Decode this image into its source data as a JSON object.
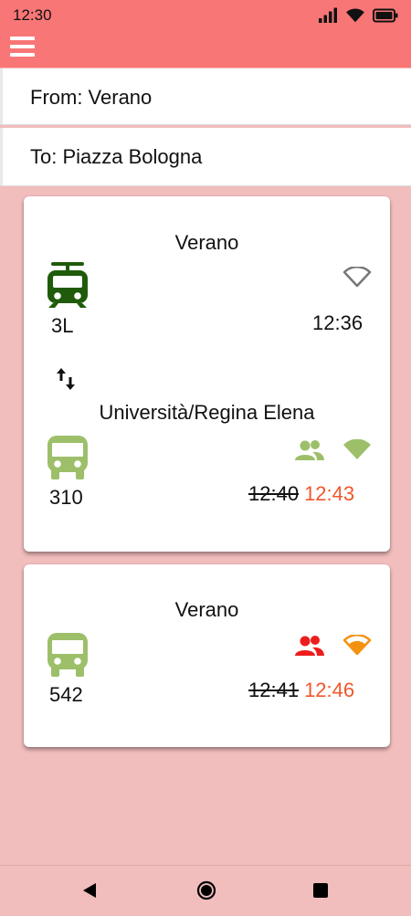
{
  "status": {
    "time": "12:30"
  },
  "search": {
    "from_text": "From: Verano",
    "to_text": "To: Piazza Bologna"
  },
  "colors": {
    "app_bar": "#f87676",
    "background": "#f2bdbd",
    "tram": "#1f5b0a",
    "bus": "#9dbf6a",
    "delay": "#f0572b",
    "crowd_high": "#ee1d1d",
    "signal_medium": "#f4920f"
  },
  "cards": [
    {
      "legs": [
        {
          "stop": "Verano",
          "vehicle_icon": "tram-icon",
          "line": "3L",
          "indicators": [
            "wifi-outline-icon"
          ],
          "scheduled_time": "12:36"
        },
        {
          "transfer_icon": "swap-vert-icon",
          "stop": "Università/Regina Elena",
          "vehicle_icon": "bus-icon",
          "line": "310",
          "indicators": [
            "crowd-low-icon",
            "signal-good-icon"
          ],
          "scheduled_time": "12:40",
          "realtime_time": "12:43"
        }
      ]
    },
    {
      "legs": [
        {
          "stop": "Verano",
          "vehicle_icon": "bus-icon",
          "line": "542",
          "indicators": [
            "crowd-high-icon",
            "signal-medium-icon"
          ],
          "scheduled_time": "12:41",
          "realtime_time": "12:46"
        }
      ]
    }
  ],
  "nav": {
    "icons": [
      "back-icon",
      "home-icon",
      "recents-icon"
    ]
  }
}
